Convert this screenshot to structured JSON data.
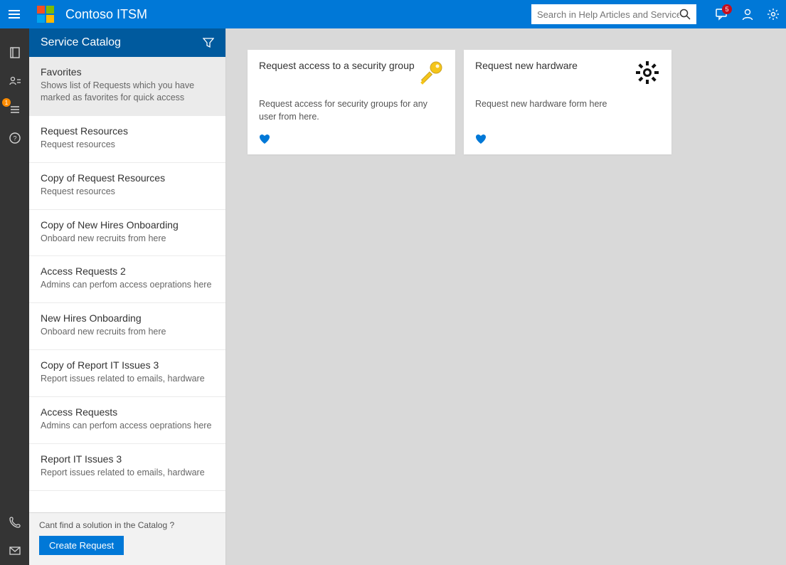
{
  "header": {
    "app_title": "Contoso ITSM",
    "search_placeholder": "Search in Help Articles and Services",
    "notification_badge": "5"
  },
  "rail": {
    "list_badge": "1"
  },
  "sidebar": {
    "title": "Service Catalog",
    "categories": [
      {
        "title": "Favorites",
        "desc": "Shows list of Requests which you have marked as favorites for quick access",
        "active": true
      },
      {
        "title": "Request Resources",
        "desc": "Request resources"
      },
      {
        "title": "Copy of Request Resources",
        "desc": "Request resources"
      },
      {
        "title": "Copy of New Hires Onboarding",
        "desc": "Onboard new recruits from here"
      },
      {
        "title": "Access Requests 2",
        "desc": "Admins can perfom access oeprations here"
      },
      {
        "title": "New Hires Onboarding",
        "desc": "Onboard new recruits from here"
      },
      {
        "title": "Copy of Report IT Issues 3",
        "desc": "Report issues related to emails, hardware"
      },
      {
        "title": "Access Requests",
        "desc": "Admins can perfom access oeprations here"
      },
      {
        "title": "Report IT Issues 3",
        "desc": "Report issues related to emails, hardware"
      }
    ],
    "footer_question": "Cant find a solution in the Catalog ?",
    "create_label": "Create Request"
  },
  "cards": [
    {
      "title": "Request access to a security group",
      "desc": "Request access for security groups for any user from here.",
      "icon": "key"
    },
    {
      "title": "Request new hardware",
      "desc": "Request new hardware form here",
      "icon": "gear"
    }
  ]
}
